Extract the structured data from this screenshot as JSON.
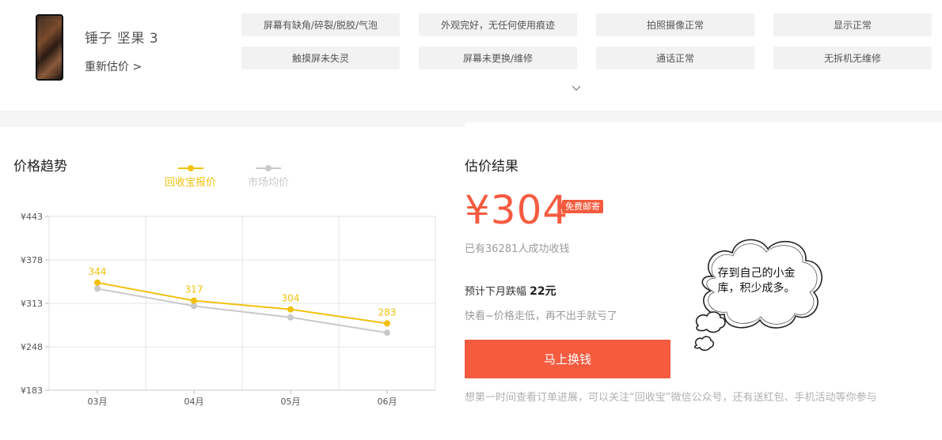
{
  "product": {
    "name": "锤子 坚果 3",
    "reestimate_label": "重新估价 >",
    "tags": [
      "屏幕有缺角/碎裂/脱胶/气泡",
      "外观完好，无任何使用痕迹",
      "拍照摄像正常",
      "显示正常",
      "触摸屏未失灵",
      "屏幕未更换/维修",
      "通话正常",
      "无拆机无维修"
    ]
  },
  "trend": {
    "title": "价格趋势",
    "legend_ours": "回收宝报价",
    "legend_market": "市场均价"
  },
  "colors": {
    "ours": "#f2c10f",
    "market": "#c9c9c9",
    "accent": "#f55b3f"
  },
  "chart_data": {
    "type": "line",
    "categories": [
      "03月",
      "04月",
      "05月",
      "06月"
    ],
    "series": [
      {
        "name": "回收宝报价",
        "values": [
          344,
          317,
          304,
          283
        ]
      },
      {
        "name": "市场均价",
        "values": [
          335,
          309,
          292,
          269
        ]
      }
    ],
    "y_ticks": [
      "¥443",
      "¥378",
      "¥313",
      "¥248",
      "¥183"
    ],
    "ylim": [
      183,
      443
    ],
    "data_labels": [
      "344",
      "317",
      "304",
      "283"
    ],
    "grid": true
  },
  "result": {
    "title": "估价结果",
    "price": "¥304",
    "badge": "免费邮寄",
    "sold_text": "已有36281人成功收钱",
    "forecast_prefix": "预计下月跌幅",
    "forecast_value": "22元",
    "hint": "快看~价格走低，再不出手就亏了",
    "cash_button": "马上换钱",
    "note": "想第一时间查看订单进展，可以关注“回收宝”微信公众号，还有送红包、手机活动等你参与",
    "cloud_text": "存到自己的小金库，积少成多。"
  }
}
